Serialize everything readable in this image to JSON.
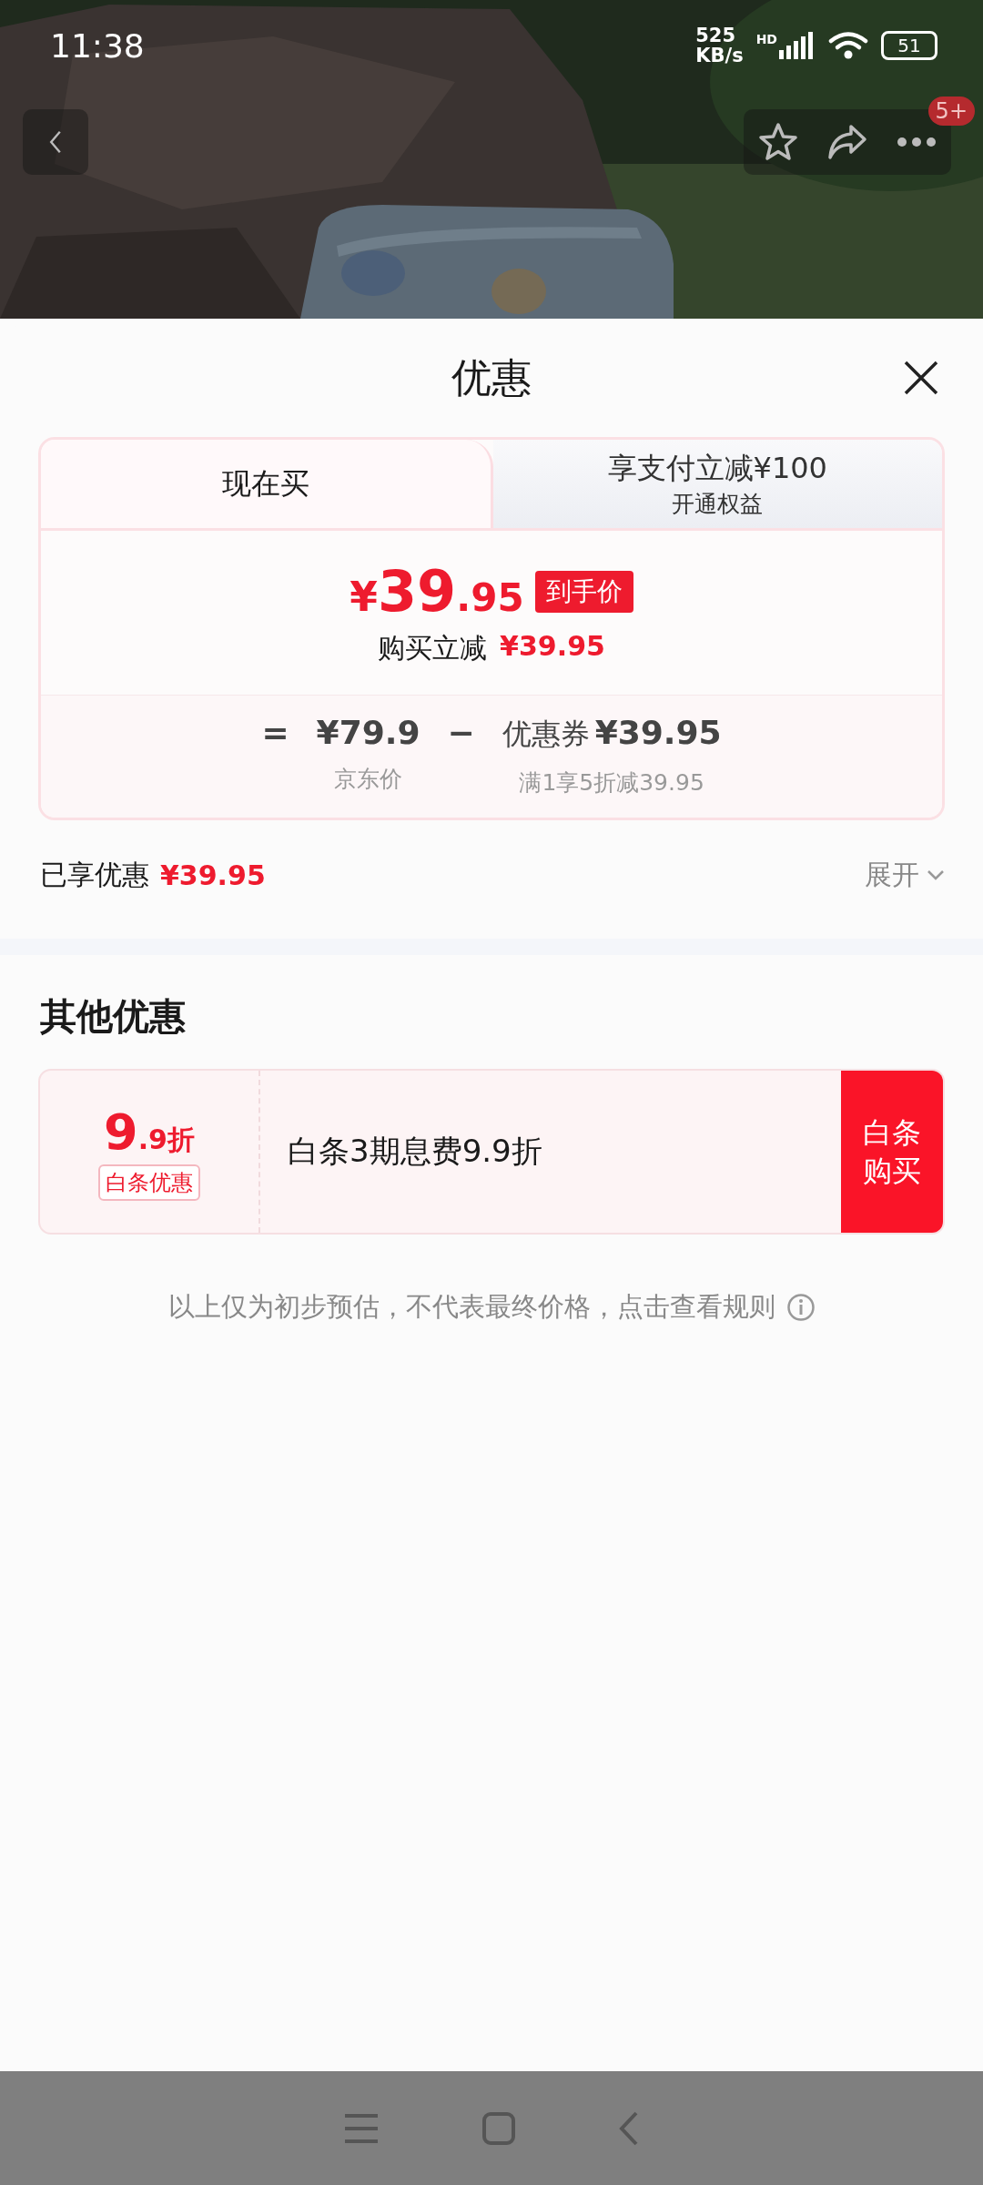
{
  "status_bar": {
    "time": "11:38",
    "net_speed": "525",
    "net_unit": "KB/s",
    "network_badge": "HD",
    "battery": "51"
  },
  "product_header": {
    "kind": "picture",
    "more_badge": "5+"
  },
  "sheet": {
    "title": "优惠",
    "tabs": [
      {
        "label": "现在买",
        "selected": true
      },
      {
        "label": "享支付立减¥100",
        "sublabel": "开通权益",
        "selected": false
      }
    ],
    "final_price": {
      "currency": "¥",
      "integer": "39",
      "decimal": ".95",
      "tag": "到手价"
    },
    "instant_discount": {
      "label": "购买立减",
      "amount": "¥39.95"
    },
    "formula": [
      {
        "kind": "operator",
        "text": "="
      },
      {
        "kind": "term",
        "value": "¥79.9",
        "caption": "京东价"
      },
      {
        "kind": "operator",
        "text": "−"
      },
      {
        "kind": "term",
        "prefix": "优惠券",
        "value": "¥39.95",
        "caption": "满1享5折减39.95"
      }
    ],
    "enjoyed": {
      "label": "已享优惠",
      "amount": "¥39.95",
      "expand": "展开"
    },
    "other_title": "其他优惠",
    "offers": [
      {
        "discount_main": "9",
        "discount_rest": ".9折",
        "tag": "白条优惠",
        "description": "白条3期息费9.9折",
        "action": "白条购买"
      }
    ],
    "disclaimer": "以上仅为初步预估，不代表最终价格，点击查看规则"
  }
}
